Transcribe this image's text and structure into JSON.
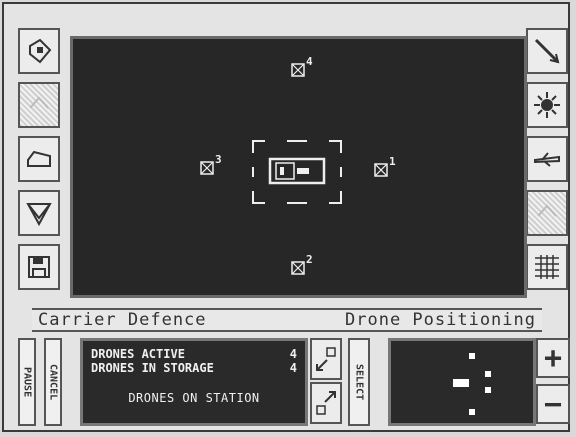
{
  "icons_left": [
    "diamond-tool-icon",
    "disabled-tool-icon",
    "box-view-icon",
    "triangle-view-icon",
    "disk-save-icon"
  ],
  "icons_right": [
    "missile-icon",
    "sun-icon",
    "aircraft-icon",
    "disabled-tool-icon",
    "grid-map-icon"
  ],
  "status": {
    "left": "Carrier Defence",
    "right": "Drone Positioning"
  },
  "buttons": {
    "pause": "PAUSE",
    "cancel": "CANCEL",
    "select": "SELECT"
  },
  "drone_labels": {
    "d1": "1",
    "d2": "2",
    "d3": "3",
    "d4": "4"
  },
  "info": {
    "active_label": "DRONES ACTIVE",
    "active_count": "4",
    "storage_label": "DRONES IN STORAGE",
    "storage_count": "4",
    "footer": "DRONES ON STATION"
  },
  "zoom": {
    "plus": "+",
    "minus": "−"
  },
  "colors": {
    "screen": "#272727",
    "panel": "#e4e4e4"
  }
}
